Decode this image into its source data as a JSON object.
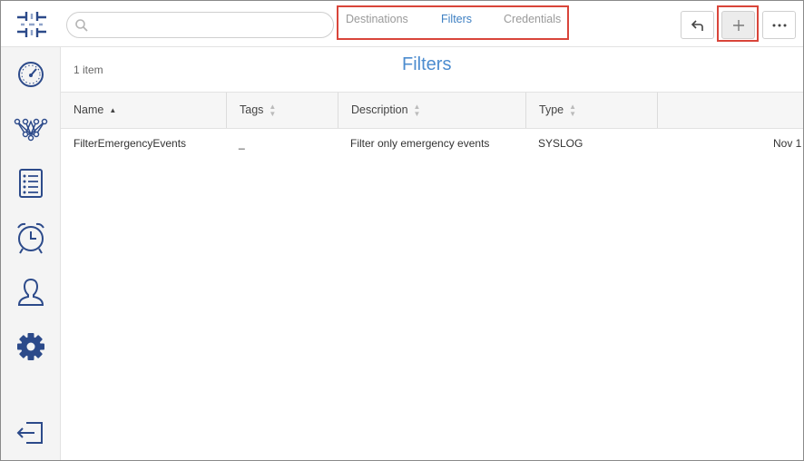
{
  "search": {
    "value": "",
    "placeholder": ""
  },
  "tabs": [
    {
      "label": "Destinations",
      "active": false
    },
    {
      "label": "Filters",
      "active": true
    },
    {
      "label": "Credentials",
      "active": false
    }
  ],
  "toolbar": {
    "back_icon": "undo-arrow-icon",
    "add_icon": "plus-icon",
    "more_icon": "ellipsis-icon"
  },
  "sidebar": {
    "items": [
      {
        "icon": "dashboard-gauge-icon"
      },
      {
        "icon": "network-topology-icon"
      },
      {
        "icon": "list-icon"
      },
      {
        "icon": "alarm-clock-icon"
      },
      {
        "icon": "user-icon"
      },
      {
        "icon": "gear-icon",
        "active": true
      },
      {
        "icon": "logout-icon"
      }
    ]
  },
  "main": {
    "item_count": "1 item",
    "title": "Filters",
    "columns": [
      {
        "label": "Name",
        "sort": "asc"
      },
      {
        "label": "Tags",
        "sort": "none"
      },
      {
        "label": "Description",
        "sort": "none"
      },
      {
        "label": "Type",
        "sort": "none"
      },
      {
        "label": "",
        "sort": "none"
      }
    ],
    "rows": [
      {
        "name": "FilterEmergencyEvents",
        "tags": "_",
        "description": "Filter only emergency events",
        "type": "SYSLOG",
        "date": "Nov 1"
      }
    ]
  },
  "colors": {
    "accent": "#4c8ccf",
    "highlight_border": "#d9453a",
    "icon_blue": "#2c4a8a"
  }
}
